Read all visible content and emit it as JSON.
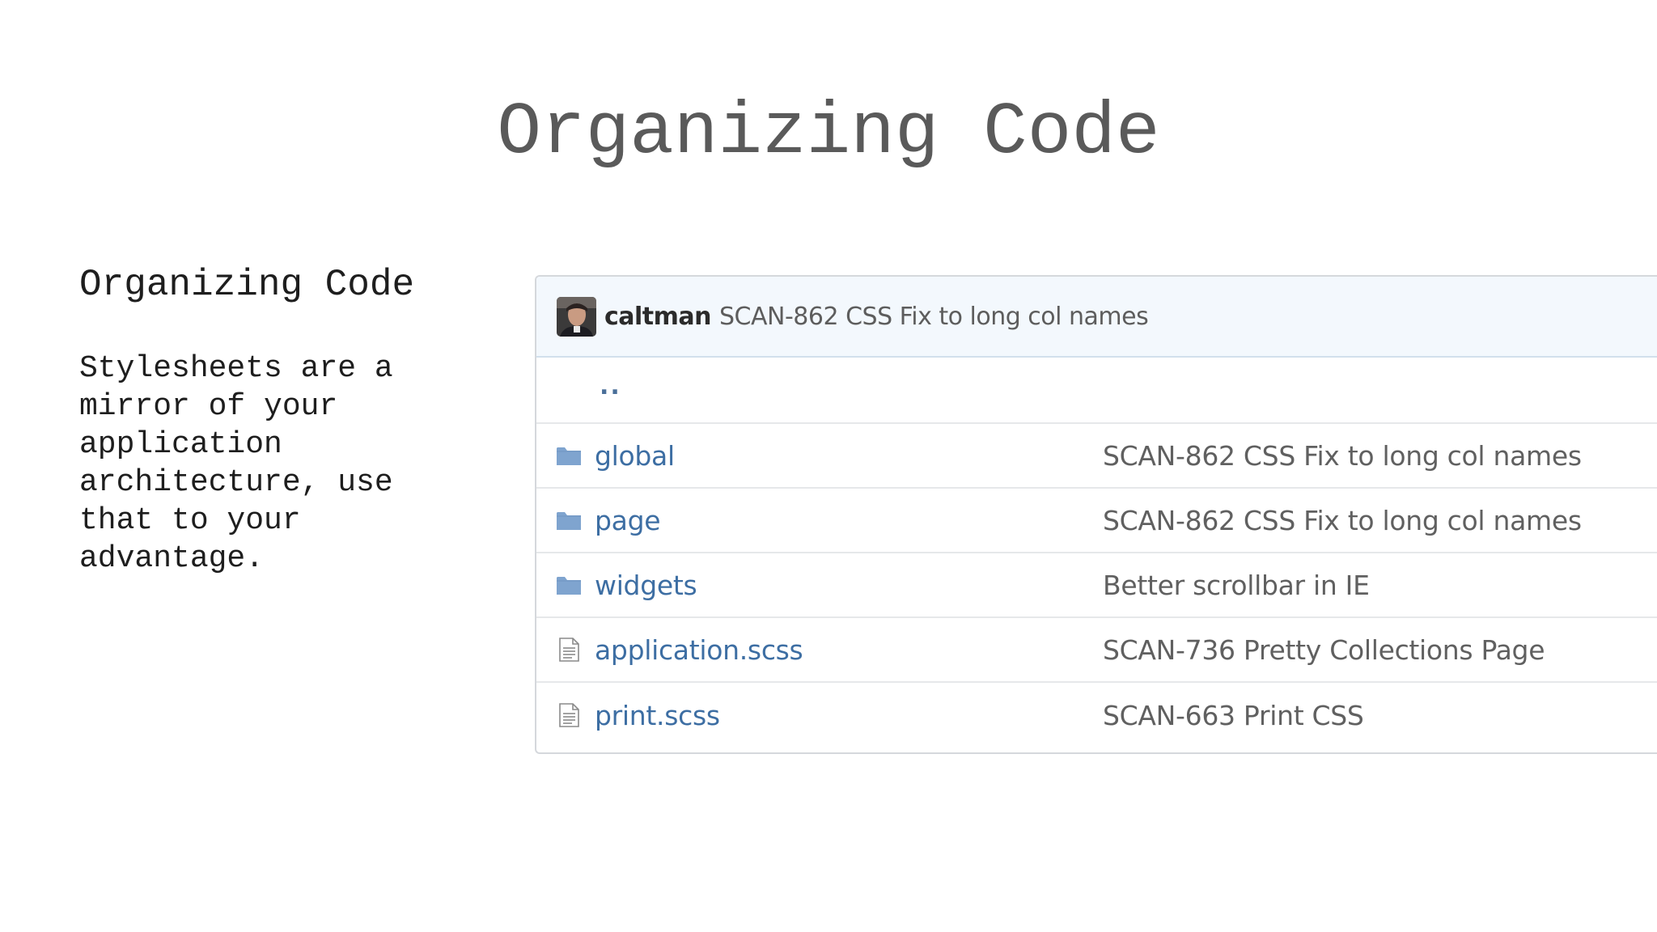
{
  "slide": {
    "title": "Organizing Code",
    "left_heading": "Organizing Code",
    "left_body": "Stylesheets are a mirror of your application architecture, use that to your advantage."
  },
  "repo": {
    "latest_commit": {
      "author": "caltman",
      "message": "SCAN-862 CSS Fix to long col names"
    },
    "parent_dir_label": "..",
    "files": [
      {
        "name": "global",
        "type": "folder",
        "icon": "folder-icon",
        "commit": "SCAN-862 CSS Fix to long col names"
      },
      {
        "name": "page",
        "type": "folder",
        "icon": "folder-icon",
        "commit": "SCAN-862 CSS Fix to long col names"
      },
      {
        "name": "widgets",
        "type": "folder",
        "icon": "folder-icon",
        "commit": "Better scrollbar in IE"
      },
      {
        "name": "application.scss",
        "type": "file",
        "icon": "file-icon",
        "commit": "SCAN-736 Pretty Collections Page"
      },
      {
        "name": "print.scss",
        "type": "file",
        "icon": "file-icon",
        "commit": "SCAN-663 Print CSS"
      }
    ]
  },
  "colors": {
    "title_text": "#5a5a5a",
    "link_blue": "#3d6ea3",
    "folder_blue": "#7fa4cf",
    "commit_bar_bg": "#f3f8fd"
  }
}
